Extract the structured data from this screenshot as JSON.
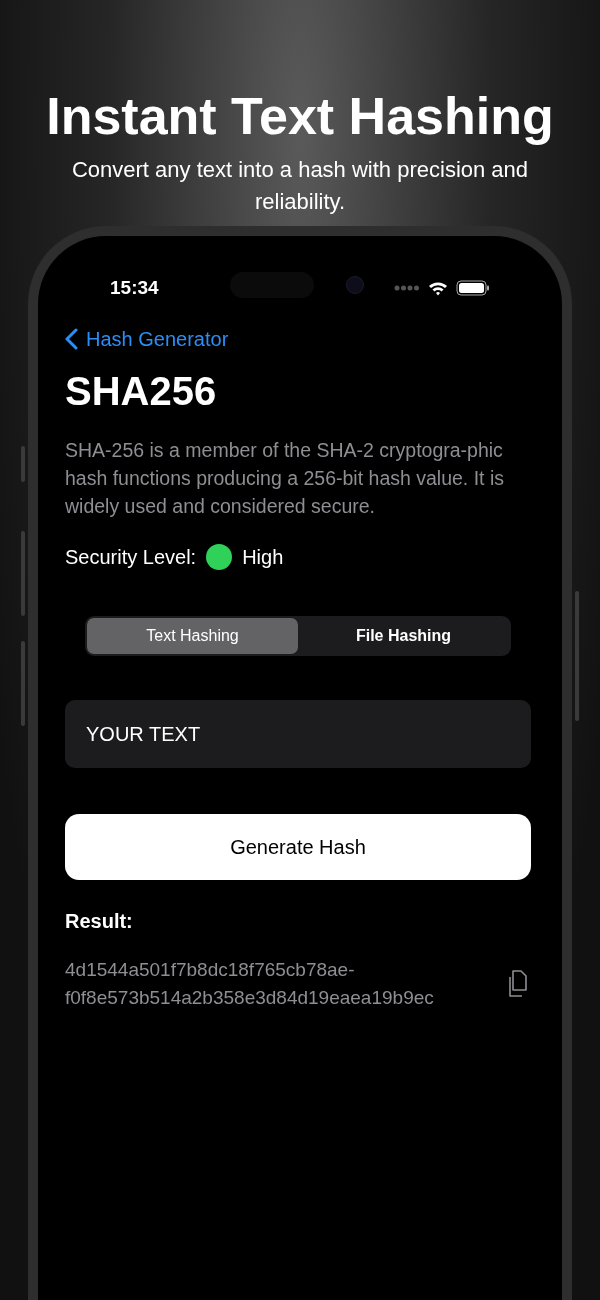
{
  "headline": "Instant Text Hashing",
  "subtitle": "Convert any text into a hash with precision and reliability.",
  "status_bar": {
    "time": "15:34"
  },
  "nav": {
    "back_label": "Hash Generator"
  },
  "title": "SHA256",
  "description": "SHA-256 is a member of the SHA-2 cryptogra-phic hash functions producing a 256-bit hash value. It is widely used and considered secure.",
  "security": {
    "label": "Security Level:",
    "value": "High",
    "color": "#30d158"
  },
  "segments": [
    {
      "label": "Text Hashing",
      "selected": true
    },
    {
      "label": "File Hashing",
      "selected": false
    }
  ],
  "input": {
    "placeholder": "YOUR TEXT"
  },
  "generate_button": "Generate Hash",
  "result": {
    "label": "Result:",
    "value": "4d1544a501f7b8dc18f765cb78ae-f0f8e573b514a2b358e3d84d19eaea19b9ec"
  }
}
